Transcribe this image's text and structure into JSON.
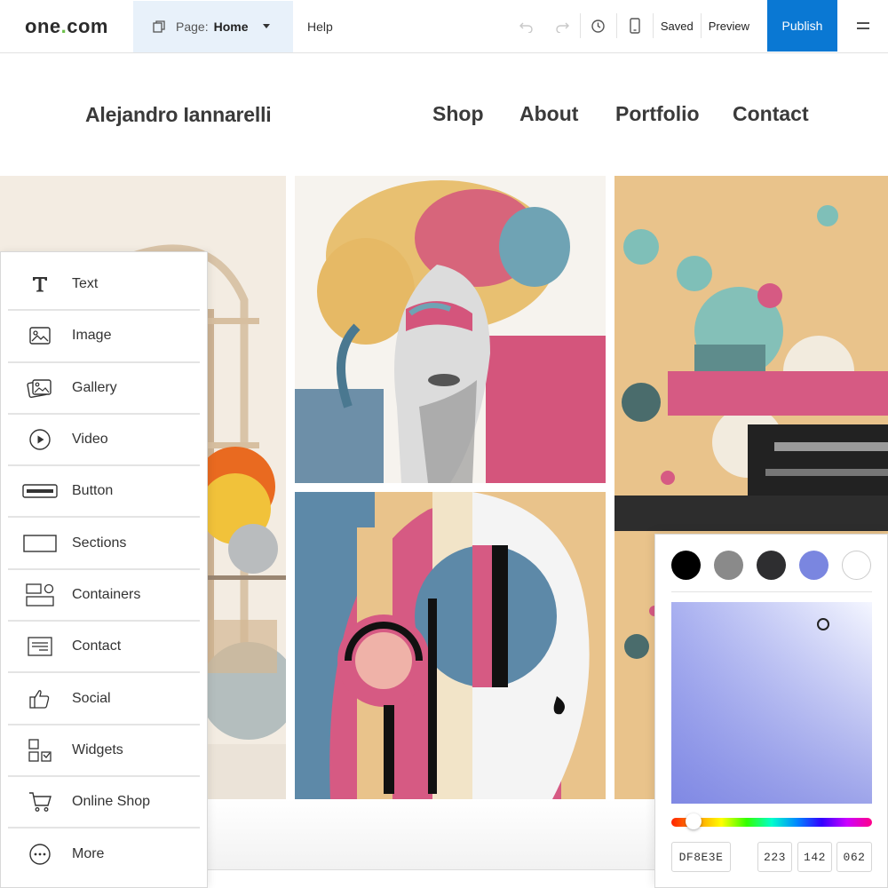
{
  "topbar": {
    "logo": {
      "text_a": "one",
      "text_dot": ".",
      "text_b": "com"
    },
    "page_selector": {
      "prefix": "Page:",
      "current": "Home"
    },
    "help_label": "Help",
    "tools": {
      "undo_icon": "undo-icon",
      "redo_icon": "redo-icon",
      "history_icon": "history-icon",
      "mobile_icon": "mobile-icon"
    },
    "saved_label": "Saved",
    "preview_label": "Preview",
    "publish_label": "Publish",
    "menu_icon": "hamburger-menu-icon"
  },
  "site": {
    "name": "Alejandro Iannarelli",
    "nav": [
      "Shop",
      "About",
      "Portfolio",
      "Contact"
    ]
  },
  "elements_panel": {
    "items": [
      {
        "label": "Text",
        "icon": "text-icon"
      },
      {
        "label": "Image",
        "icon": "image-icon"
      },
      {
        "label": "Gallery",
        "icon": "gallery-icon"
      },
      {
        "label": "Video",
        "icon": "video-play-icon"
      },
      {
        "label": "Button",
        "icon": "button-icon"
      },
      {
        "label": "Sections",
        "icon": "sections-icon"
      },
      {
        "label": "Containers",
        "icon": "containers-icon"
      },
      {
        "label": "Contact",
        "icon": "contact-form-icon"
      },
      {
        "label": "Social",
        "icon": "thumbs-up-icon"
      },
      {
        "label": "Widgets",
        "icon": "widgets-icon"
      },
      {
        "label": "Online Shop",
        "icon": "shopping-cart-icon"
      },
      {
        "label": "More",
        "icon": "more-dots-icon"
      }
    ]
  },
  "color_picker": {
    "swatches": [
      "#000000",
      "#8a8a8a",
      "#2e2e30",
      "#7a86e0",
      "#ffffff"
    ],
    "hex": "DF8E3E",
    "r": "223",
    "g": "142",
    "b": "062"
  }
}
